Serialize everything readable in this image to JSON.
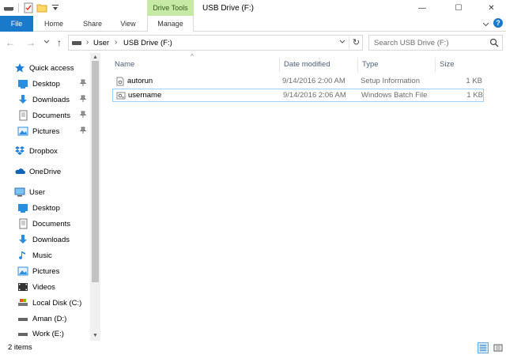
{
  "window": {
    "title": "USB Drive (F:)",
    "context_tab_group": "Drive Tools",
    "minimize_glyph": "—",
    "maximize_glyph": "☐",
    "close_glyph": "✕"
  },
  "ribbon": {
    "tabs": [
      {
        "label": "File",
        "active": false
      },
      {
        "label": "Home",
        "active": false
      },
      {
        "label": "Share",
        "active": false
      },
      {
        "label": "View",
        "active": false
      },
      {
        "label": "Manage",
        "active": true
      }
    ],
    "expand_glyph": "⌄",
    "help_glyph": "?"
  },
  "address": {
    "back_glyph": "←",
    "forward_glyph": "→",
    "recent_glyph": "⌄",
    "up_glyph": "↑",
    "crumbs": [
      "User",
      "USB Drive (F:)"
    ],
    "separator": "›",
    "dropdown_glyph": "⌄",
    "refresh_glyph": "↻"
  },
  "search": {
    "placeholder": "Search USB Drive (F:)"
  },
  "nav_pane": {
    "items": [
      {
        "label": "Quick access",
        "icon": "star-icon",
        "pinned": false
      },
      {
        "label": "Desktop",
        "icon": "desktop-folder-icon",
        "pinned": true
      },
      {
        "label": "Downloads",
        "icon": "downloads-icon",
        "pinned": true
      },
      {
        "label": "Documents",
        "icon": "documents-icon",
        "pinned": true
      },
      {
        "label": "Pictures",
        "icon": "pictures-icon",
        "pinned": true
      },
      {
        "label": "Dropbox",
        "icon": "dropbox-icon",
        "pinned": false
      },
      {
        "label": "OneDrive",
        "icon": "onedrive-icon",
        "pinned": false
      },
      {
        "label": "User",
        "icon": "computer-icon",
        "pinned": false
      },
      {
        "label": "Desktop",
        "icon": "desktop-folder-icon",
        "pinned": false
      },
      {
        "label": "Documents",
        "icon": "documents-icon",
        "pinned": false
      },
      {
        "label": "Downloads",
        "icon": "downloads-icon",
        "pinned": false
      },
      {
        "label": "Music",
        "icon": "music-icon",
        "pinned": false
      },
      {
        "label": "Pictures",
        "icon": "pictures-icon",
        "pinned": false
      },
      {
        "label": "Videos",
        "icon": "videos-icon",
        "pinned": false
      },
      {
        "label": "Local Disk (C:)",
        "icon": "local-disk-icon",
        "pinned": false
      },
      {
        "label": "Aman (D:)",
        "icon": "drive-icon",
        "pinned": false
      },
      {
        "label": "Work (E:)",
        "icon": "drive-icon",
        "pinned": false
      }
    ],
    "pin_glyph": "📌",
    "scroll_up_glyph": "▲",
    "scroll_down_glyph": "▼"
  },
  "file_list": {
    "sort_glyph": "^",
    "columns": [
      "Name",
      "Date modified",
      "Type",
      "Size"
    ],
    "rows": [
      {
        "name": "autorun",
        "date": "9/14/2016 2:00 AM",
        "type": "Setup Information",
        "size": "1 KB",
        "icon": "settings-file-icon",
        "selected": false
      },
      {
        "name": "username",
        "date": "9/14/2016 2:06 AM",
        "type": "Windows Batch File",
        "size": "1 KB",
        "icon": "batch-file-icon",
        "selected": true
      }
    ]
  },
  "status": {
    "item_count": "2 items"
  },
  "colors": {
    "accent": "#1979ca",
    "context_tab": "#c7e9a6",
    "selection_border": "#99d1ff",
    "column_header_text": "#4c607a"
  }
}
